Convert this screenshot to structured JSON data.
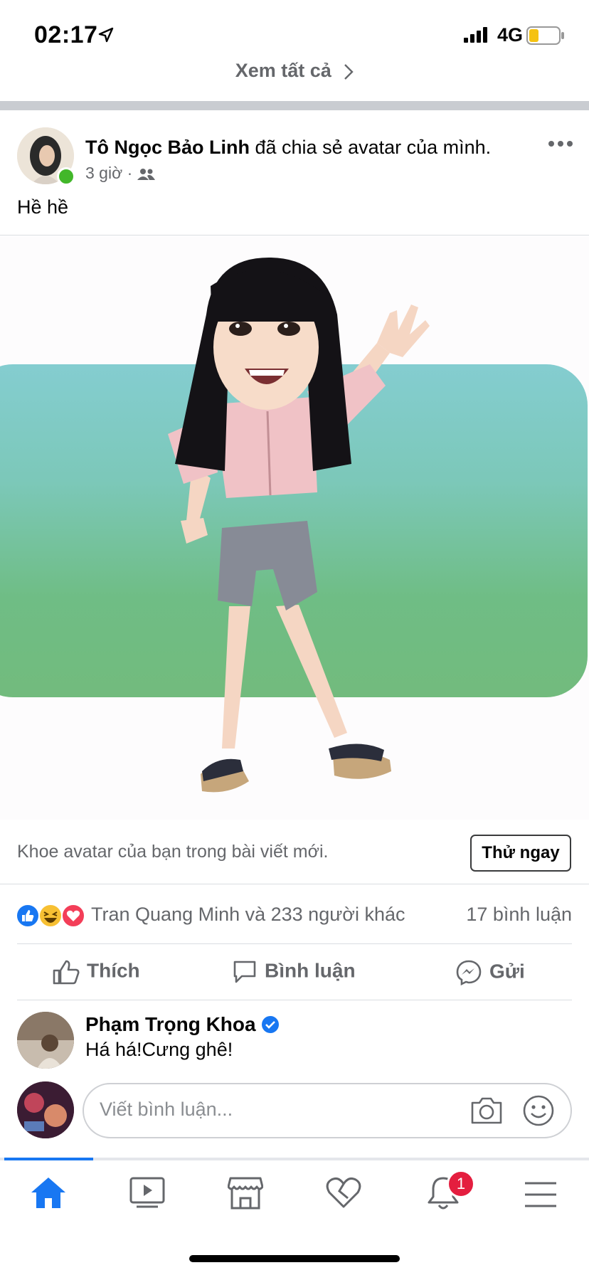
{
  "status_bar": {
    "time": "02:17",
    "network": "4G",
    "battery_color": "#f5c211"
  },
  "see_all": {
    "label": "Xem tất cả"
  },
  "post": {
    "author": "Tô Ngọc Bảo Linh",
    "action_text": "đã chia sẻ avatar của mình.",
    "time": "3 giờ",
    "separator": "·",
    "audience_icon": "friends-icon",
    "text": "Hề hề",
    "promo_text": "Khoe avatar của bạn trong bài viết mới.",
    "try_button": "Thử ngay",
    "reactions": [
      "like",
      "haha",
      "love"
    ],
    "reactors": "Tran Quang Minh và 233 người khác",
    "comment_count": "17 bình luận"
  },
  "actions": {
    "like": "Thích",
    "comment": "Bình luận",
    "send": "Gửi"
  },
  "comment": {
    "author": "Phạm Trọng Khoa",
    "text": "Há há!Cưng ghê!",
    "verified": true
  },
  "comment_input": {
    "placeholder": "Viết bình luận..."
  },
  "nav": {
    "items": [
      "home-icon",
      "watch-icon",
      "marketplace-icon",
      "dating-heart-icon",
      "notifications-icon",
      "menu-icon"
    ],
    "active": "home-icon",
    "notification_badge": "1"
  },
  "colors": {
    "accent": "#1877f2",
    "secondary_text": "#65676b",
    "online": "#42b72a",
    "badge": "#e41e3f"
  }
}
